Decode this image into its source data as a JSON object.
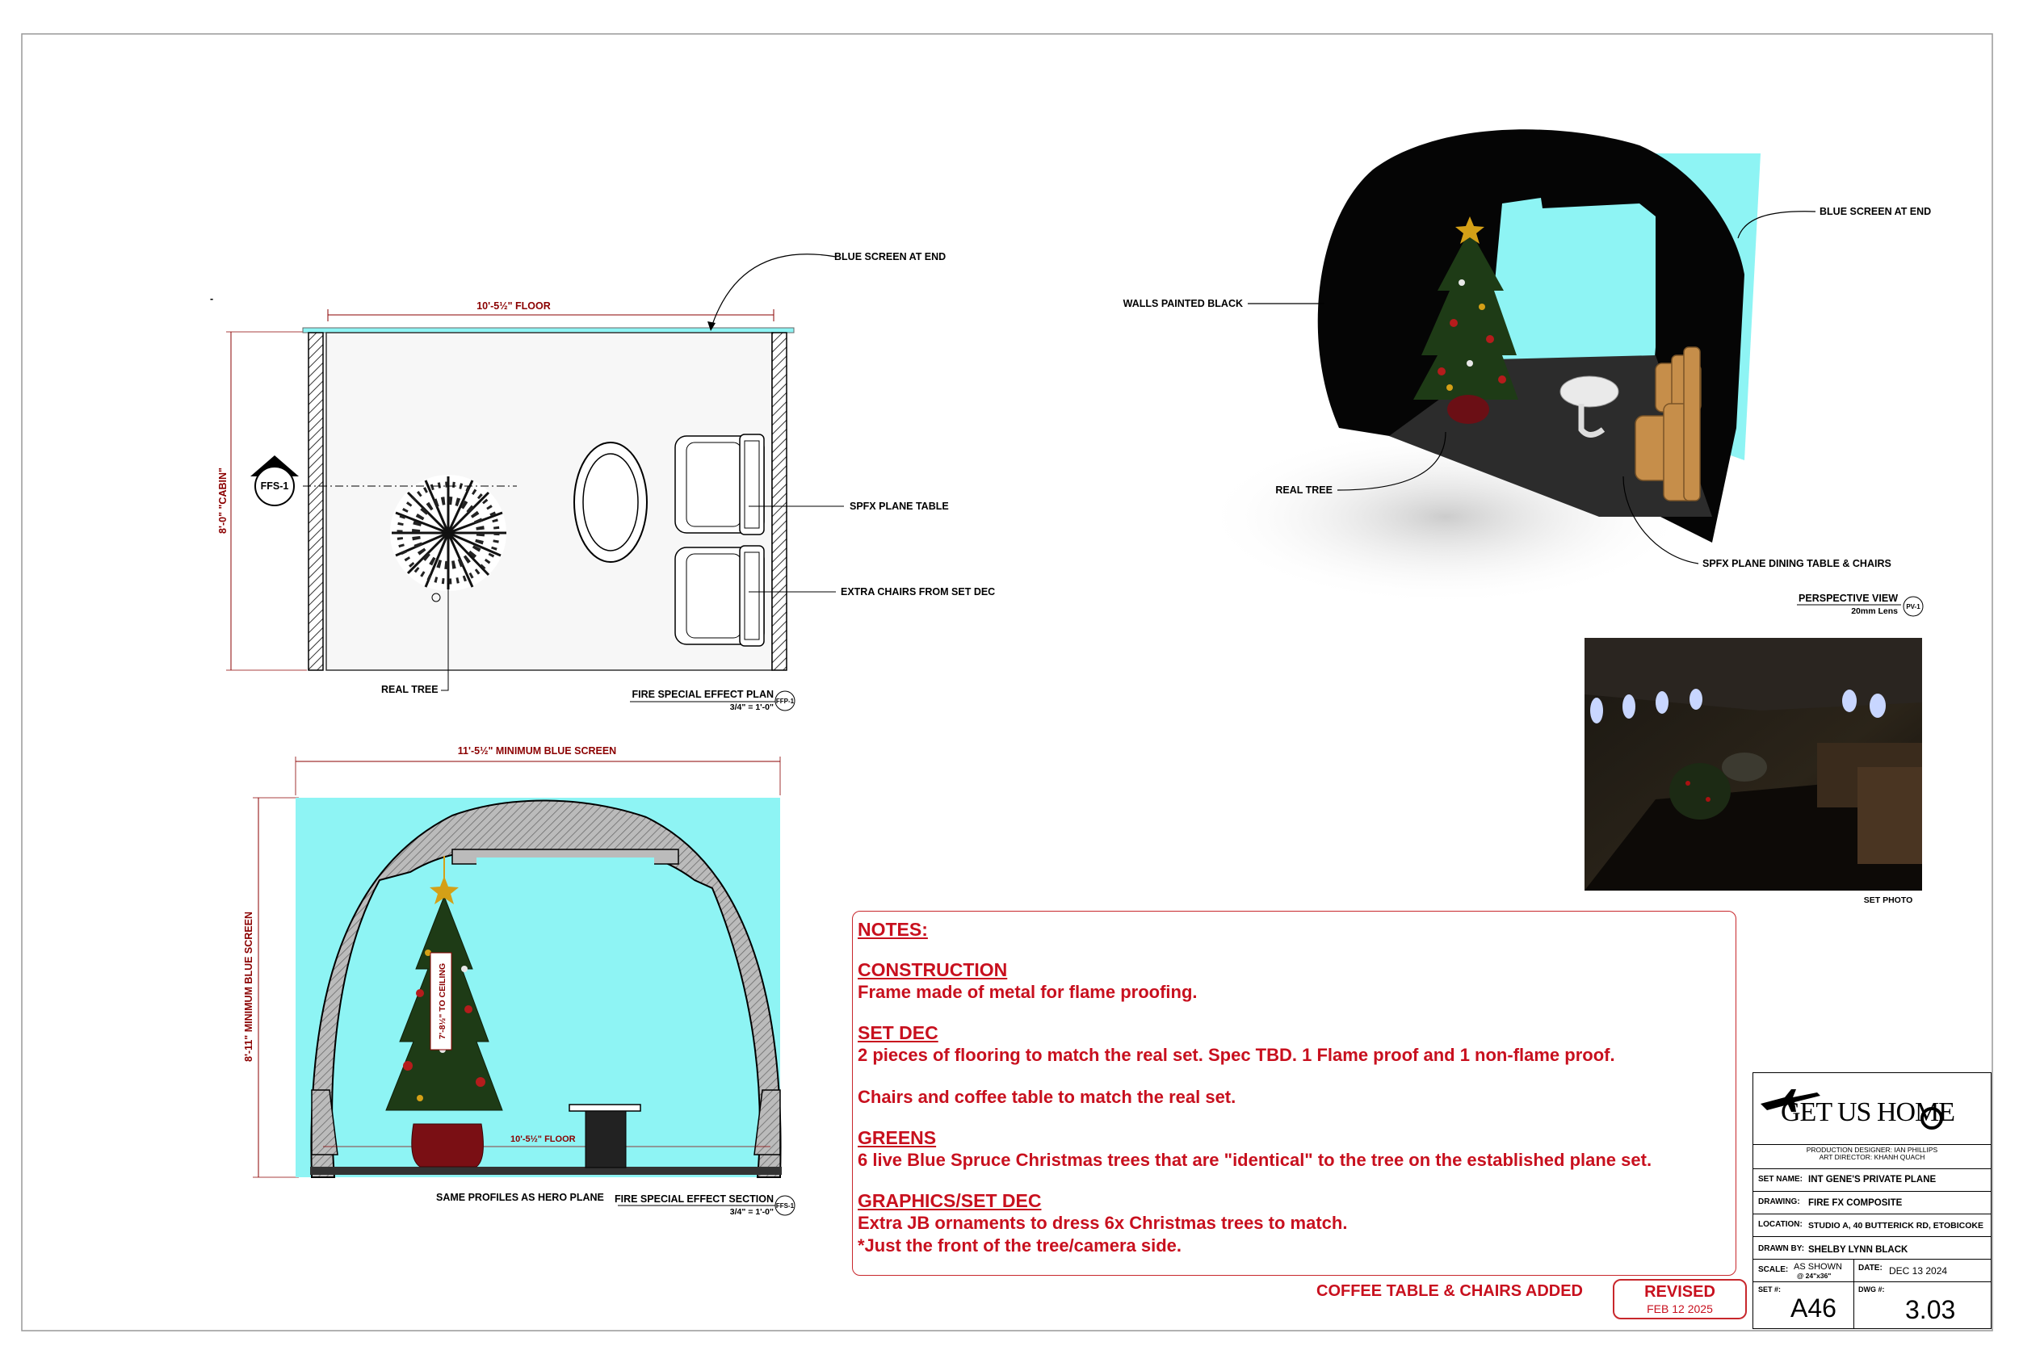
{
  "plan": {
    "floor_dim": "10'-5½\" FLOOR",
    "cabin_dim": "8'-0\" \"CABIN\"",
    "blue_screen_callout": "BLUE SCREEN AT END",
    "spfx_table_callout": "SPFX PLANE TABLE",
    "extra_chairs_callout": "EXTRA CHAIRS FROM SET DEC",
    "real_tree_callout": "REAL TREE",
    "section_marker": "FFS-1",
    "view_title": "FIRE SPECIAL EFFECT PLAN",
    "view_scale": "3/4\" = 1'-0\"",
    "view_tag": "FFP-1"
  },
  "perspective": {
    "blue_screen_callout": "BLUE SCREEN AT END",
    "walls_callout": "WALLS PAINTED BLACK",
    "real_tree_callout": "REAL TREE",
    "dining_callout": "SPFX PLANE DINING TABLE & CHAIRS",
    "view_title": "PERSPECTIVE VIEW",
    "view_lens": "20mm Lens",
    "view_tag": "PV-1"
  },
  "set_photo": {
    "caption": "SET PHOTO"
  },
  "section": {
    "width_dim": "11'-5½\" MINIMUM BLUE SCREEN",
    "height_dim": "8'-11\" MINIMUM BLUE SCREEN",
    "tree_dim": "7'-8½\" TO CEILING",
    "floor_dim": "10'-5½\" FLOOR",
    "profiles_note": "SAME PROFILES AS HERO PLANE",
    "view_title": "FIRE SPECIAL EFFECT SECTION",
    "view_scale": "3/4\" = 1'-0\"",
    "view_tag": "FFS-1"
  },
  "notes": {
    "title": "NOTES:",
    "sections": [
      {
        "heading": "CONSTRUCTION",
        "body": "Frame made of metal for flame proofing."
      },
      {
        "heading": "SET DEC",
        "body": "2 pieces of flooring to match the real set. Spec TBD. 1 Flame proof and 1 non-flame proof.",
        "body2": "Chairs and coffee table to match the real set."
      },
      {
        "heading": "GREENS",
        "body": "6 live Blue Spruce Christmas trees that are \"identical\" to the tree on the established plane set."
      },
      {
        "heading": "GRAPHICS/SET DEC",
        "body": "Extra JB ornaments to dress 6x Christmas trees to match.\n*Just the front of the tree/camera side."
      }
    ]
  },
  "revision": {
    "note": "COFFEE TABLE & CHAIRS ADDED",
    "label": "REVISED",
    "date": "FEB 12 2025"
  },
  "title_block": {
    "logo_text": "GET US HOME",
    "credit1": "PRODUCTION DESIGNER: IAN PHILLIPS",
    "credit2": "ART DIRECTOR:  KHANH QUACH",
    "set_name_label": "SET NAME:",
    "set_name": "INT GENE'S PRIVATE PLANE",
    "drawing_label": "DRAWING:",
    "drawing": "FIRE FX COMPOSITE",
    "location_label": "LOCATION:",
    "location": "STUDIO A, 40 BUTTERICK RD, ETOBICOKE",
    "drawn_by_label": "DRAWN BY:",
    "drawn_by": "SHELBY LYNN BLACK",
    "scale_label": "SCALE:",
    "scale": "AS SHOWN",
    "scale_sub": "@ 24\"x36\"",
    "date_label": "DATE:",
    "date": "DEC 13 2024",
    "set_no_label": "SET #:",
    "set_no": "A46",
    "dwg_label": "DWG #:",
    "dwg_no": "3.03"
  },
  "colors": {
    "blue_screen": "#8ef4f4",
    "notes_red": "#c8101e",
    "dim_red": "#8b0000"
  }
}
